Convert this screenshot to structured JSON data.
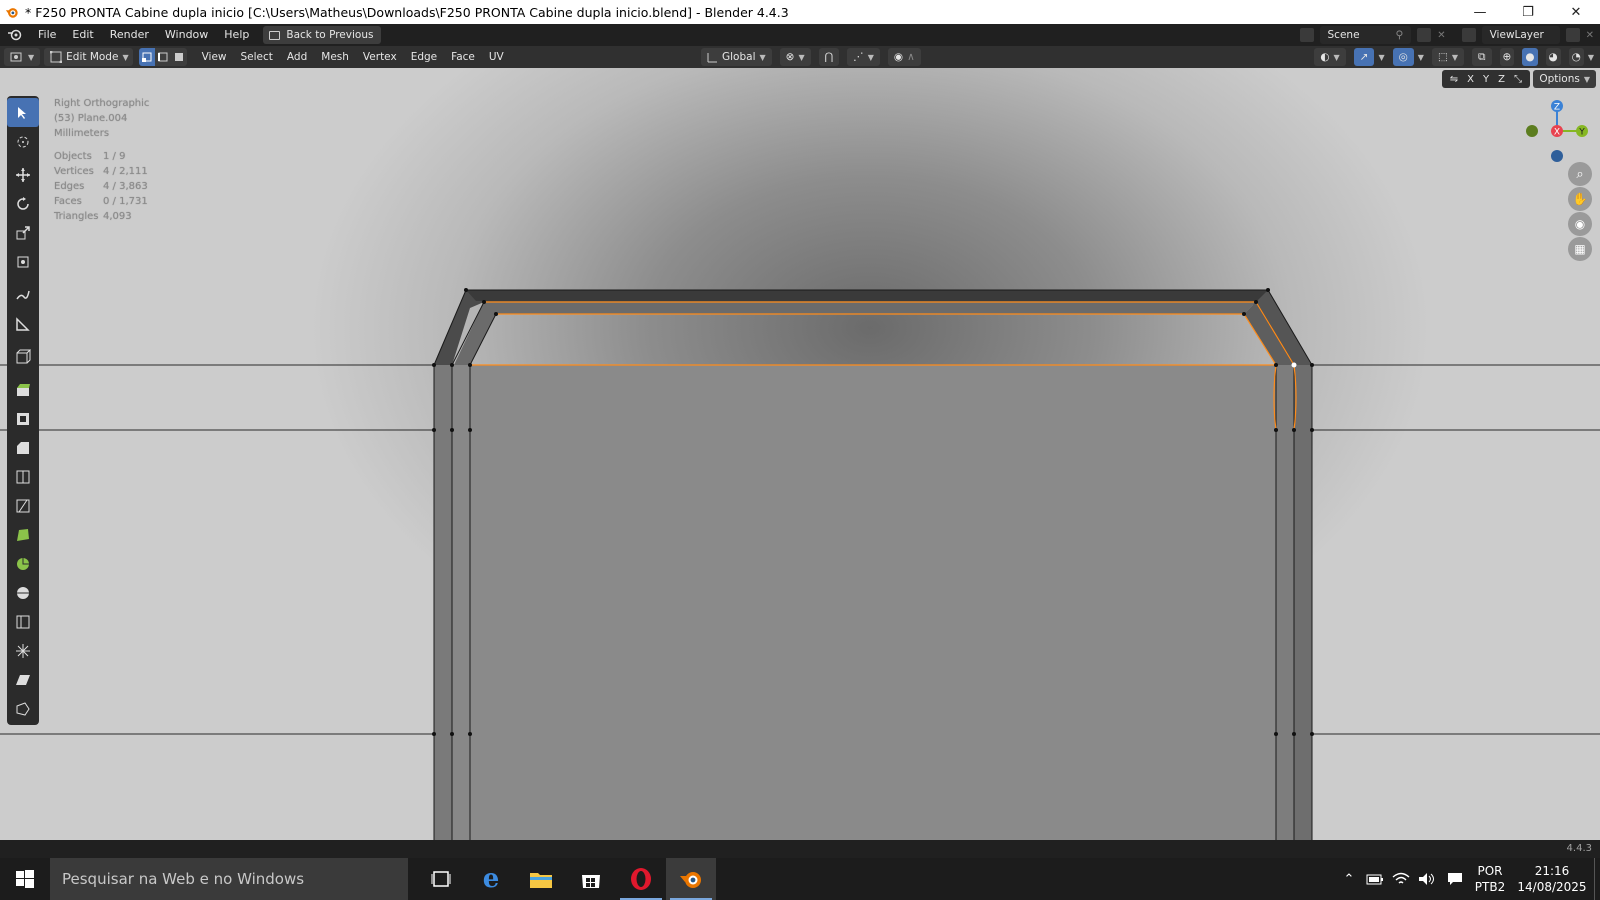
{
  "window": {
    "title": "* F250 PRONTA Cabine dupla inicio [C:\\Users\\Matheus\\Downloads\\F250 PRONTA Cabine dupla inicio.blend] - Blender 4.4.3",
    "minimize": "—",
    "maximize": "❐",
    "close": "✕"
  },
  "topbar": {
    "menus": [
      "File",
      "Edit",
      "Render",
      "Window",
      "Help"
    ],
    "back_button": "Back to Previous",
    "scene": "Scene",
    "view_layer": "ViewLayer"
  },
  "header": {
    "mode": "Edit Mode",
    "menus": [
      "View",
      "Select",
      "Add",
      "Mesh",
      "Vertex",
      "Edge",
      "Face",
      "UV"
    ],
    "transform_orientation": "Global",
    "options": "Options",
    "axes": [
      "X",
      "Y",
      "Z"
    ]
  },
  "viewport": {
    "view_name": "Right Orthographic",
    "object_name": "(53) Plane.004",
    "units": "Millimeters",
    "stats": [
      {
        "label": "Objects",
        "value": "1 / 9"
      },
      {
        "label": "Vertices",
        "value": "4 / 2,111"
      },
      {
        "label": "Edges",
        "value": "4 / 3,863"
      },
      {
        "label": "Faces",
        "value": "0 / 1,731"
      },
      {
        "label": "Triangles",
        "value": "4,093"
      }
    ],
    "gizmo_axes": {
      "z": "Z",
      "x": "X",
      "y": "Y"
    },
    "colors": {
      "selection": "#ff8c1a",
      "axis_x": "#e8424f",
      "axis_y": "#86b723",
      "axis_z": "#3b82d6",
      "active_tool": "#4772b3"
    }
  },
  "statusbar": {
    "version": "4.4.3"
  },
  "taskbar": {
    "search_placeholder": "Pesquisar na Web e no Windows",
    "language_top": "POR",
    "language_bottom": "PTB2",
    "time": "21:16",
    "date": "14/08/2025"
  }
}
